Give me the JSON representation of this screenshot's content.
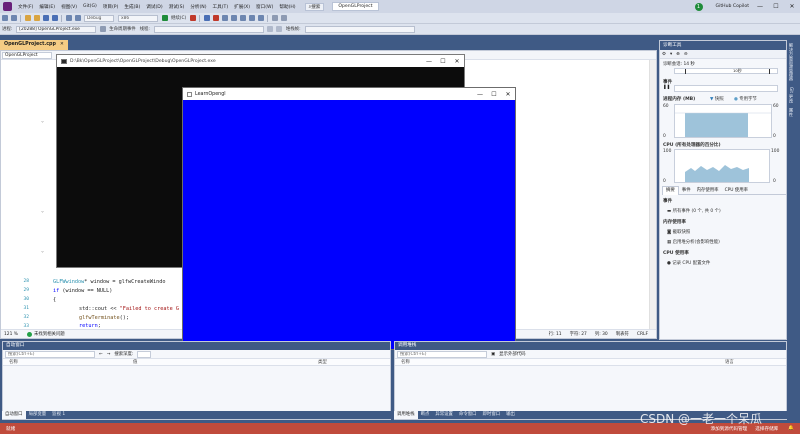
{
  "menu": {
    "items": [
      "文件(F)",
      "编辑(E)",
      "视图(V)",
      "Git(G)",
      "项目(P)",
      "生成(B)",
      "调试(D)",
      "测试(S)",
      "分析(N)",
      "工具(T)",
      "扩展(X)",
      "窗口(W)",
      "帮助(H)"
    ],
    "search_label": "搜索",
    "project_name": "OpenGLProject",
    "notification_count": "1",
    "copilot": "GitHub Copilot",
    "win_min": "—",
    "win_max": "☐",
    "win_close": "✕"
  },
  "toolbar": {
    "config": "Debug",
    "platform": "x86",
    "continue_label": "继续(C)",
    "process_label": "进程:",
    "process_value": "[20288] OpenGLProject.exe",
    "lifecycle_label": "生命周期事件",
    "thread_label": "线程:",
    "stack_label": "堆栈帧:"
  },
  "editor": {
    "tab_label": "OpenGLProject.cpp",
    "tab_close": "✕",
    "scope_combo": "OpenGLProject",
    "line_numbers": [
      "28",
      "29",
      "30",
      "31",
      "32",
      "33"
    ],
    "status": {
      "zoom": "121 %",
      "issues": "未找到相关问题",
      "line": "行: 11",
      "char": "字符: 27",
      "col": "列: 30",
      "tabs": "制表符",
      "eol": "CRLF"
    }
  },
  "code": {
    "l28_type": "GLFWwindow",
    "l28_rest": "* window = glfwCreateWindo",
    "l29_kw": "if",
    "l29_rest": " (window == NULL)",
    "l30": "{",
    "l31_a": "std::cout << ",
    "l31_str": "\"Failed to create G",
    "l32_fn": "glfwTerminate",
    "l32_rest": "();",
    "l33_kw": "return",
    "l33_rest": ";"
  },
  "console": {
    "title": "D:\\Bk\\OpenGLProject\\OpenGLProject\\Debug\\OpenGLProject.exe",
    "min": "—",
    "max": "☐",
    "close": "✕"
  },
  "glwindow": {
    "title": "LearnOpengl",
    "min": "—",
    "max": "☐",
    "close": "✕",
    "clear_color": "#0000ff"
  },
  "diagnostics": {
    "title": "诊断工具",
    "session_label": "诊断会话: 14 秒",
    "timeline_tick": "10秒",
    "events_title": "事件",
    "memory_title": "进程内存 (MB)",
    "legend_snapshot": "快照",
    "legend_private": "专用字节",
    "mem_axis_top": "60",
    "mem_axis_bottom": "0",
    "cpu_title": "CPU (所有处理器的百分比)",
    "cpu_axis_top": "100",
    "cpu_axis_bottom": "0",
    "tabs": [
      "摘要",
      "事件",
      "内存使用率",
      "CPU 使用率"
    ],
    "events_section": "事件",
    "events_row": "所有事件 (0 个, 共 0 个)",
    "memory_section": "内存使用率",
    "memory_row1": "截取快照",
    "memory_row2": "启用堆分析(会影响性能)",
    "cpu_section": "CPU 使用率",
    "cpu_row": "记录 CPU 配置文件"
  },
  "right_strip": [
    "解决方案资源管理器",
    "Git 更改",
    "属性"
  ],
  "autos": {
    "title": "自动窗口",
    "search_placeholder": "搜索(Ctrl+E)",
    "search_depth": "搜索深度:",
    "col_name": "名称",
    "col_value": "值",
    "col_type": "类型",
    "tabs": [
      "自动窗口",
      "局部变量",
      "监视 1"
    ]
  },
  "callstack": {
    "title": "调用堆栈",
    "search_placeholder": "搜索(Ctrl+E)",
    "show_external": "显示外部代码",
    "col_name": "名称",
    "col_lang": "语言",
    "tabs": [
      "调用堆栈",
      "断点",
      "异常设置",
      "命令窗口",
      "即时窗口",
      "输出"
    ]
  },
  "statusbar": {
    "ready": "就绪",
    "add_source": "添加到源代码管理",
    "select_repo": "选择存储库"
  },
  "watermark": "CSDN @一老一个呆瓜"
}
